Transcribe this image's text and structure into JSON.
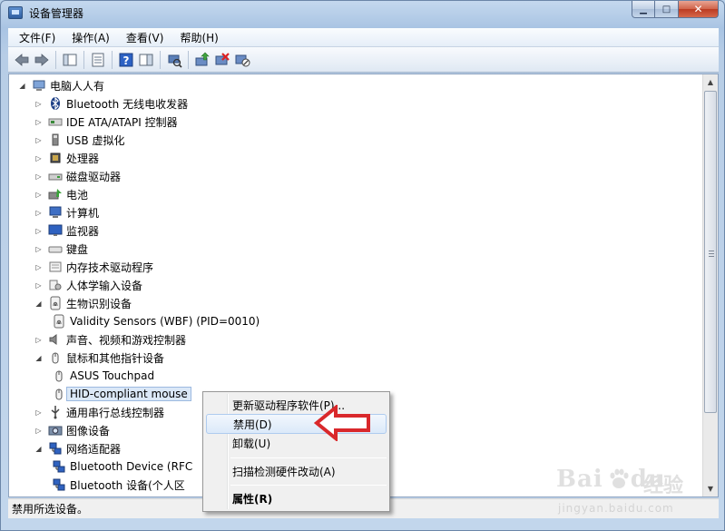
{
  "window": {
    "title": "设备管理器",
    "min_glyph": "▁",
    "max_glyph": "□",
    "close_glyph": "✕"
  },
  "menubar": {
    "items": [
      "文件(F)",
      "操作(A)",
      "查看(V)",
      "帮助(H)"
    ]
  },
  "toolbar": {
    "buttons": [
      "back-icon",
      "forward-icon",
      "show-hide-tree-icon",
      "properties-icon",
      "help-icon",
      "action-pane-icon",
      "scan-hardware-icon",
      "update-driver-icon",
      "uninstall-icon",
      "disable-icon"
    ]
  },
  "tree": {
    "root": "电脑人人有",
    "items": [
      {
        "label": "Bluetooth 无线电收发器",
        "icon": "bluetooth-icon",
        "expander": "▷"
      },
      {
        "label": "IDE ATA/ATAPI 控制器",
        "icon": "ide-controller-icon",
        "expander": "▷"
      },
      {
        "label": "USB 虚拟化",
        "icon": "usb-icon",
        "expander": "▷"
      },
      {
        "label": "处理器",
        "icon": "processor-icon",
        "expander": "▷"
      },
      {
        "label": "磁盘驱动器",
        "icon": "disk-drive-icon",
        "expander": "▷"
      },
      {
        "label": "电池",
        "icon": "battery-icon",
        "expander": "▷"
      },
      {
        "label": "计算机",
        "icon": "computer-icon",
        "expander": "▷"
      },
      {
        "label": "监视器",
        "icon": "monitor-icon",
        "expander": "▷"
      },
      {
        "label": "键盘",
        "icon": "keyboard-icon",
        "expander": "▷"
      },
      {
        "label": "内存技术驱动程序",
        "icon": "memory-tech-icon",
        "expander": "▷"
      },
      {
        "label": "人体学输入设备",
        "icon": "hid-icon",
        "expander": "▷"
      },
      {
        "label": "生物识别设备",
        "icon": "biometric-icon",
        "expander": "◢"
      },
      {
        "label": "Validity Sensors (WBF) (PID=0010)",
        "icon": "fingerprint-icon",
        "child": true
      },
      {
        "label": "声音、视频和游戏控制器",
        "icon": "sound-icon",
        "expander": "▷"
      },
      {
        "label": "鼠标和其他指针设备",
        "icon": "mouse-icon",
        "expander": "◢"
      },
      {
        "label": "ASUS Touchpad",
        "icon": "mouse-icon",
        "child": true
      },
      {
        "label": "HID-compliant mouse",
        "icon": "mouse-icon",
        "child": true,
        "selected": true
      },
      {
        "label": "通用串行总线控制器",
        "icon": "usb-controller-icon",
        "expander": "▷"
      },
      {
        "label": "图像设备",
        "icon": "camera-icon",
        "expander": "▷"
      },
      {
        "label": "网络适配器",
        "icon": "network-adapter-icon",
        "expander": "◢"
      },
      {
        "label": "Bluetooth Device (RFC",
        "icon": "network-adapter-icon",
        "child": true
      },
      {
        "label": "Bluetooth 设备(个人区",
        "icon": "network-adapter-icon",
        "child": true
      }
    ]
  },
  "context_menu": {
    "items": [
      {
        "label": "更新驱动程序软件(P)..."
      },
      {
        "label": "禁用(D)",
        "hover": true
      },
      {
        "label": "卸载(U)"
      },
      {
        "label": "扫描检测硬件改动(A)"
      },
      {
        "label": "属性(R)",
        "bold": true
      }
    ]
  },
  "statusbar": {
    "text": "禁用所选设备。"
  },
  "watermark": {
    "brand": "Bai",
    "brand2": "du",
    "cn": "经验",
    "url": "jingyan.baidu.com"
  },
  "colors": {
    "accent_red": "#d9282b",
    "selection": "#dbe8f7"
  }
}
